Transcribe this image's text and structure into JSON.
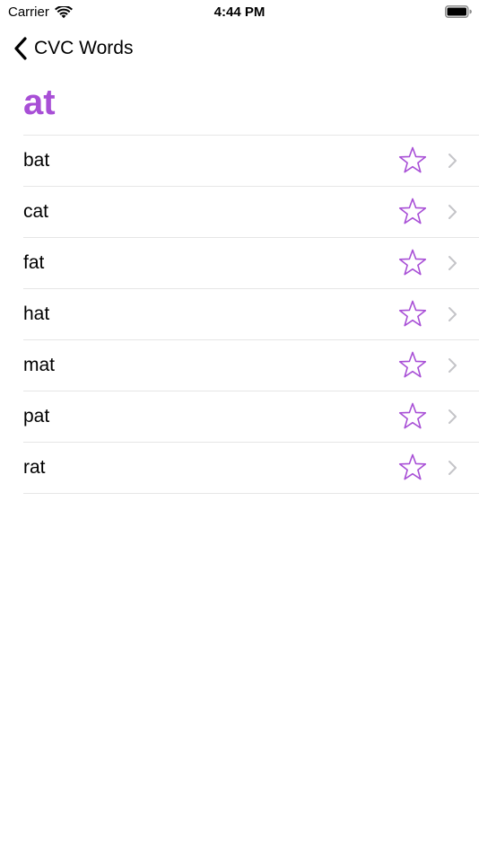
{
  "status_bar": {
    "carrier": "Carrier",
    "time": "4:44 PM",
    "icons": [
      "wifi-icon",
      "battery-icon"
    ]
  },
  "nav": {
    "back_label": "CVC Words",
    "back_icon": "chevron-left-icon"
  },
  "page": {
    "title": "at"
  },
  "words": [
    {
      "label": "bat",
      "favorite": false
    },
    {
      "label": "cat",
      "favorite": false
    },
    {
      "label": "fat",
      "favorite": false
    },
    {
      "label": "hat",
      "favorite": false
    },
    {
      "label": "mat",
      "favorite": false
    },
    {
      "label": "pat",
      "favorite": false
    },
    {
      "label": "rat",
      "favorite": false
    }
  ],
  "row_icons": {
    "favorite": "star-outline-icon",
    "disclosure": "chevron-right-icon"
  },
  "colors": {
    "accent": "#a84fd6",
    "separator": "#e6e6e6",
    "disclosure": "#c4c4c8",
    "text": "#000000"
  }
}
